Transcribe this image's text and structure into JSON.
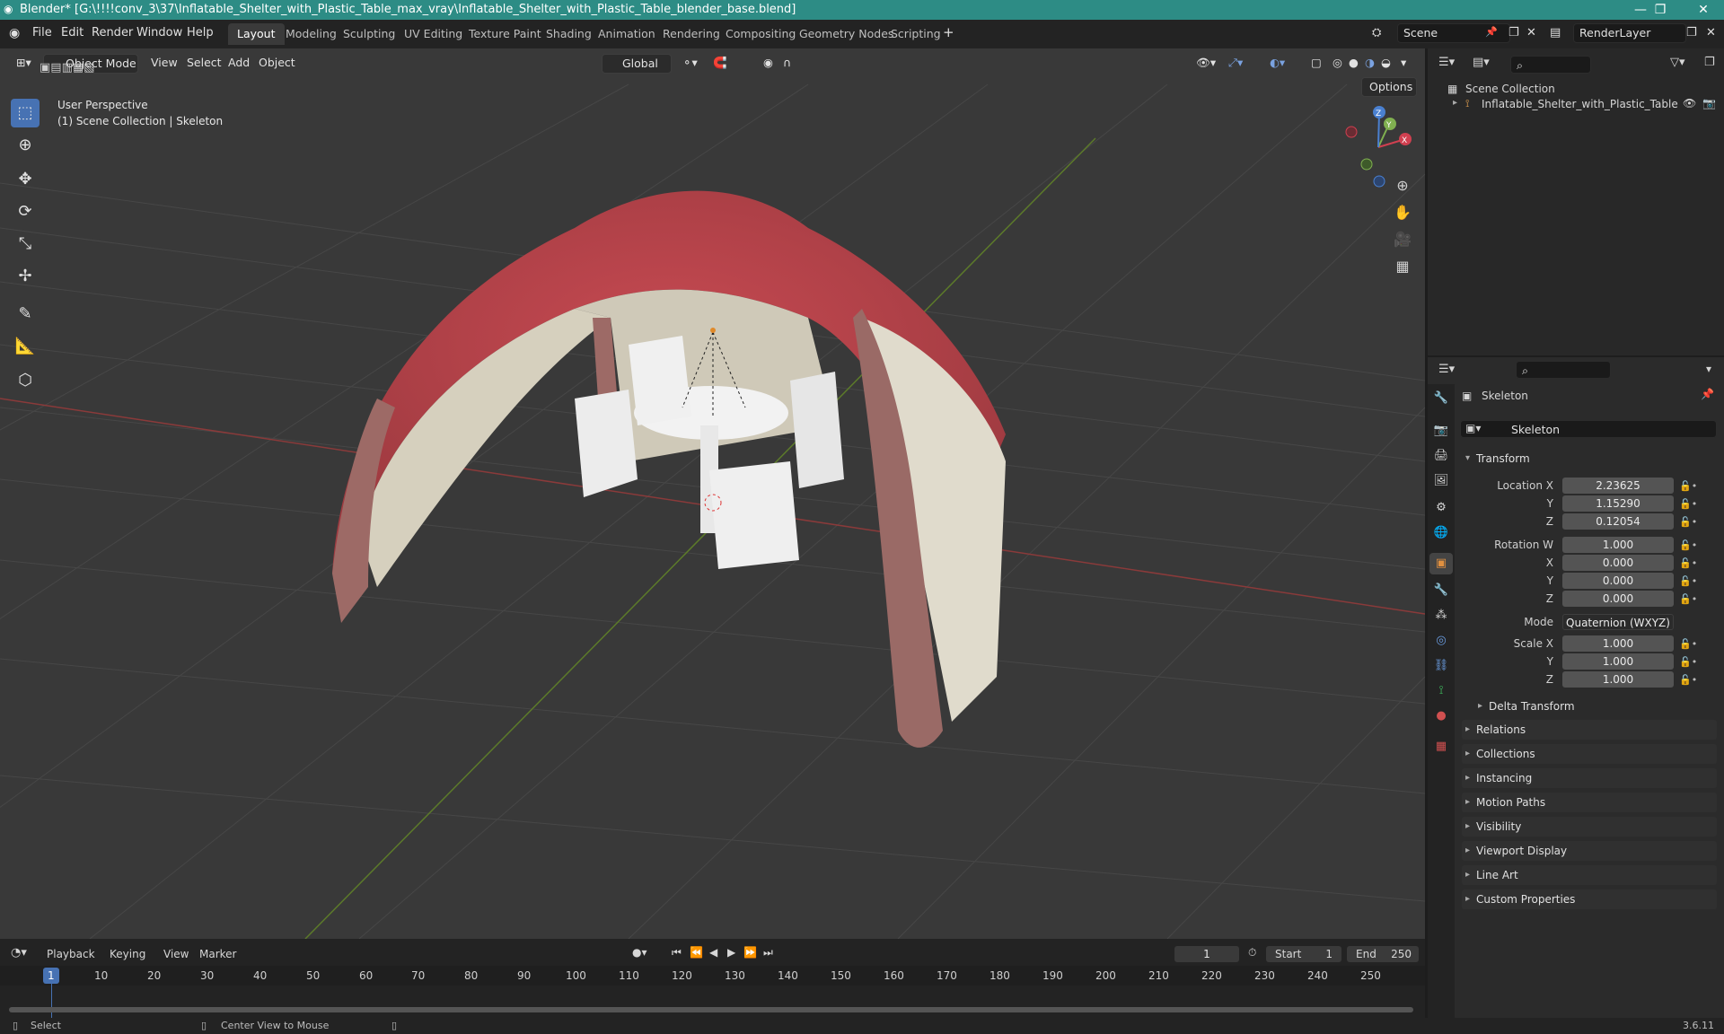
{
  "window": {
    "title": "Blender* [G:\\!!!!conv_3\\37\\Inflatable_Shelter_with_Plastic_Table_max_vray\\Inflatable_Shelter_with_Plastic_Table_blender_base.blend]"
  },
  "menu": {
    "file": "File",
    "edit": "Edit",
    "render": "Render",
    "window": "Window",
    "help": "Help"
  },
  "workspaces": [
    "Layout",
    "Modeling",
    "Sculpting",
    "UV Editing",
    "Texture Paint",
    "Shading",
    "Animation",
    "Rendering",
    "Compositing",
    "Geometry Nodes",
    "Scripting"
  ],
  "scene": {
    "name": "Scene",
    "view_layer": "RenderLayer"
  },
  "viewport": {
    "mode": "Object Mode",
    "menus": [
      "View",
      "Select",
      "Add",
      "Object"
    ],
    "orientation": "Global",
    "options_label": "Options",
    "overlay_line1": "User Perspective",
    "overlay_line2": "(1) Scene Collection | Skeleton",
    "gizmo_axes": {
      "x": "X",
      "y": "Y",
      "z": "Z"
    }
  },
  "outliner": {
    "root": "Scene Collection",
    "items": [
      {
        "name": "Inflatable_Shelter_with_Plastic_Table"
      }
    ]
  },
  "properties": {
    "object_name": "Skeleton",
    "data_name": "Skeleton",
    "transform": {
      "header": "Transform",
      "location_label": "Location X",
      "location": [
        "2.23625",
        "1.15290",
        "0.12054"
      ],
      "rotation_label": "Rotation W",
      "rotation": [
        "1.000",
        "0.000",
        "0.000",
        "0.000"
      ],
      "mode_label": "Mode",
      "mode_value": "Quaternion (WXYZ)",
      "scale_label": "Scale X",
      "scale": [
        "1.000",
        "1.000",
        "1.000"
      ],
      "axis_y": "Y",
      "axis_z": "Z",
      "axis_x": "X",
      "delta": "Delta Transform"
    },
    "panels": [
      "Relations",
      "Collections",
      "Instancing",
      "Motion Paths",
      "Visibility",
      "Viewport Display",
      "Line Art",
      "Custom Properties"
    ]
  },
  "timeline": {
    "menus": [
      "Playback",
      "Keying",
      "View",
      "Marker"
    ],
    "current_frame": "1",
    "start_label": "Start",
    "start": "1",
    "end_label": "End",
    "end": "250",
    "ruler": [
      "1",
      "10",
      "20",
      "30",
      "40",
      "50",
      "60",
      "70",
      "80",
      "90",
      "100",
      "110",
      "120",
      "130",
      "140",
      "150",
      "160",
      "170",
      "180",
      "190",
      "200",
      "210",
      "220",
      "230",
      "240",
      "250"
    ]
  },
  "status": {
    "select": "Select",
    "center_view": "Center View to Mouse",
    "version": "3.6.11"
  },
  "colors": {
    "accent": "#4772b3",
    "titlebar": "#2d8c85",
    "tent_red": "#c0414a",
    "tent_wall": "#d9d4c4"
  }
}
